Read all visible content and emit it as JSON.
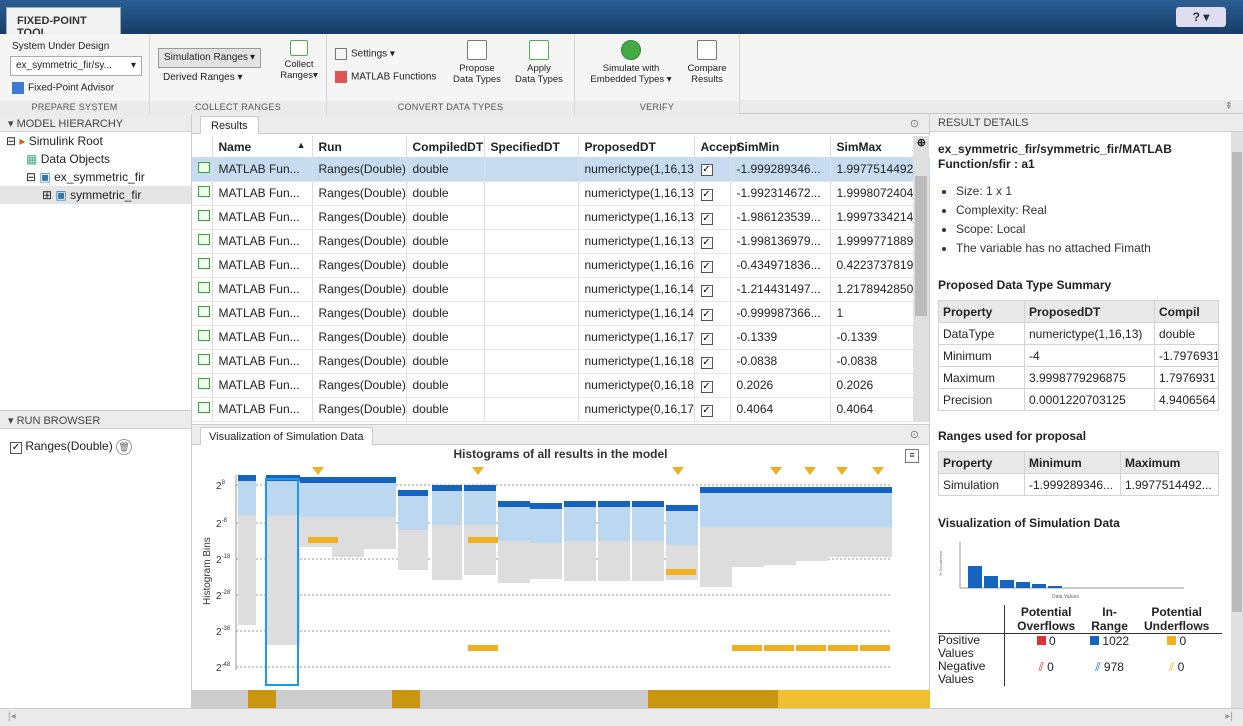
{
  "app": {
    "tab": "FIXED-POINT TOOL",
    "help": "?"
  },
  "ribbon": {
    "sud_label": "System Under Design",
    "sud_value": "ex_symmetric_fir/sy...",
    "advisor": "Fixed-Point Advisor",
    "prepare": "PREPARE SYSTEM",
    "sim_ranges": "Simulation Ranges",
    "derived": "Derived Ranges",
    "collect": "Collect",
    "collect2": "Ranges",
    "collect_label": "COLLECT RANGES",
    "settings": "Settings",
    "matlab_fns": "MATLAB Functions",
    "propose": "Propose",
    "propose2": "Data Types",
    "apply": "Apply",
    "apply2": "Data Types",
    "convert_label": "CONVERT DATA TYPES",
    "simulate": "Simulate with",
    "simulate2": "Embedded Types",
    "compare": "Compare",
    "compare2": "Results",
    "verify_label": "VERIFY"
  },
  "hier": {
    "title": "MODEL HIERARCHY",
    "items": [
      "Simulink Root",
      "Data Objects",
      "ex_symmetric_fir",
      "symmetric_fir"
    ]
  },
  "runs": {
    "title": "RUN BROWSER",
    "item": "Ranges(Double)"
  },
  "results": {
    "tab": "Results",
    "headers": [
      "Name",
      "Run",
      "CompiledDT",
      "SpecifiedDT",
      "ProposedDT",
      "Accept",
      "SimMin",
      "SimMax"
    ],
    "rows": [
      [
        "MATLAB Fun...",
        "Ranges(Double)",
        "double",
        "",
        "numerictype(1,16,13)",
        "",
        "-1.999289346...",
        "1.9977514492..."
      ],
      [
        "MATLAB Fun...",
        "Ranges(Double)",
        "double",
        "",
        "numerictype(1,16,13)",
        "",
        "-1.992314672...",
        "1.9998072404..."
      ],
      [
        "MATLAB Fun...",
        "Ranges(Double)",
        "double",
        "",
        "numerictype(1,16,13)",
        "",
        "-1.986123539...",
        "1.9997334214..."
      ],
      [
        "MATLAB Fun...",
        "Ranges(Double)",
        "double",
        "",
        "numerictype(1,16,13)",
        "",
        "-1.998136979...",
        "1.9999771889..."
      ],
      [
        "MATLAB Fun...",
        "Ranges(Double)",
        "double",
        "",
        "numerictype(1,16,16)",
        "",
        "-0.434971836...",
        "0.4223737819..."
      ],
      [
        "MATLAB Fun...",
        "Ranges(Double)",
        "double",
        "",
        "numerictype(1,16,14)",
        "",
        "-1.214431497...",
        "1.2178942850..."
      ],
      [
        "MATLAB Fun...",
        "Ranges(Double)",
        "double",
        "",
        "numerictype(1,16,14)",
        "",
        "-0.999987366...",
        "1"
      ],
      [
        "MATLAB Fun...",
        "Ranges(Double)",
        "double",
        "",
        "numerictype(1,16,17)",
        "",
        "-0.1339",
        "-0.1339"
      ],
      [
        "MATLAB Fun...",
        "Ranges(Double)",
        "double",
        "",
        "numerictype(1,16,18)",
        "",
        "-0.0838",
        "-0.0838"
      ],
      [
        "MATLAB Fun...",
        "Ranges(Double)",
        "double",
        "",
        "numerictype(0,16,18)",
        "",
        "0.2026",
        "0.2026"
      ],
      [
        "MATLAB Fun...",
        "Ranges(Double)",
        "double",
        "",
        "numerictype(0,16,17)",
        "",
        "0.4064",
        "0.4064"
      ]
    ]
  },
  "viz": {
    "tab": "Visualization of Simulation Data",
    "title": "Histograms of all results in the model",
    "ylabel": "Histogram Bins",
    "ticks": [
      "2",
      "2",
      "2",
      "2",
      "2",
      "2"
    ],
    "exps": [
      "8",
      "-8",
      "-18",
      "-28",
      "-38",
      "-48"
    ]
  },
  "details": {
    "title": "RESULT DETAILS",
    "path": "ex_symmetric_fir/symmetric_fir/MATLAB Function/sfir : a1",
    "bullets": [
      "Size: 1 x 1",
      "Complexity: Real",
      "Scope: Local",
      "The variable has no attached Fimath"
    ],
    "summary_title": "Proposed Data Type Summary",
    "summary_headers": [
      "Property",
      "ProposedDT",
      "Compil"
    ],
    "summary_rows": [
      [
        "DataType",
        "numerictype(1,16,13)",
        "double"
      ],
      [
        "Minimum",
        "-4",
        "-1.7976931"
      ],
      [
        "Maximum",
        "3.9998779296875",
        "1.7976931"
      ],
      [
        "Precision",
        "0.0001220703125",
        "4.9406564"
      ]
    ],
    "ranges_title": "Ranges used for proposal",
    "ranges_headers": [
      "Property",
      "Minimum",
      "Maximum"
    ],
    "ranges_row": [
      "Simulation",
      "-1.999289346...",
      "1.9977514492..."
    ],
    "viz_title": "Visualization of Simulation Data",
    "mini_xlabel": "Data Values",
    "mini_ylabel": "% Occurrence",
    "ov_headers": [
      "Potential Overflows",
      "In-Range",
      "Potential Underflows"
    ],
    "ov_rows": [
      [
        "Positive Values",
        "0",
        "1022",
        "0"
      ],
      [
        "Negative Values",
        "0",
        "978",
        "0"
      ]
    ]
  }
}
